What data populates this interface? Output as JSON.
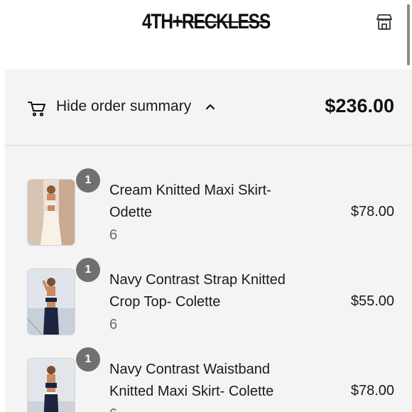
{
  "header": {
    "logo_part1": "4TH",
    "logo_part2": "+",
    "logo_part3": "RECKLESS",
    "store_icon": "store-icon"
  },
  "summary": {
    "cart_icon": "cart-icon",
    "toggle_label": "Hide order summary",
    "chevron_icon": "chevron-up-icon",
    "total": "$236.00"
  },
  "items": [
    {
      "quantity": "1",
      "name": "Cream Knitted Maxi Skirt- Odette",
      "variant": "6",
      "price": "$78.00"
    },
    {
      "quantity": "1",
      "name": "Navy Contrast Strap Knitted Crop Top- Colette",
      "variant": "6",
      "price": "$55.00"
    },
    {
      "quantity": "1",
      "name": "Navy Contrast Waistband Knitted Maxi Skirt- Colette",
      "variant": "6",
      "price": "$78.00"
    }
  ]
}
